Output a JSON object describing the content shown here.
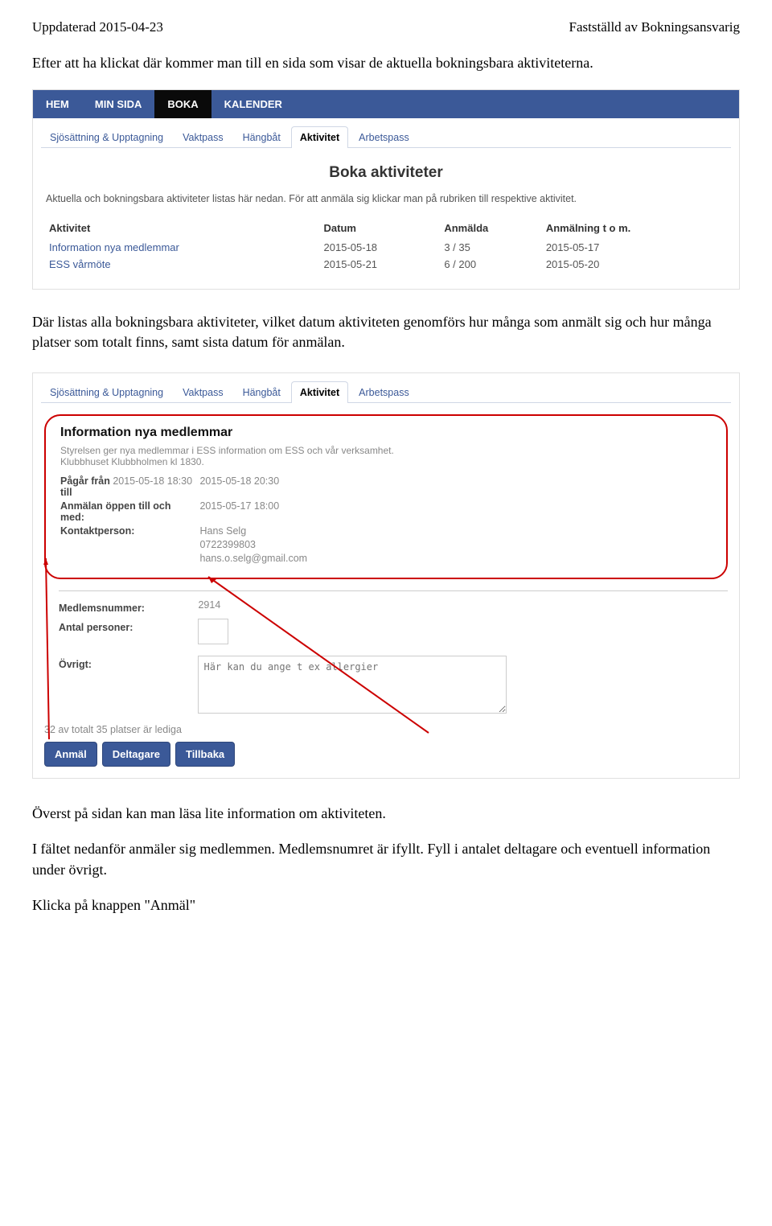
{
  "doc": {
    "updated": "Uppdaterad 2015-04-23",
    "right_header": "Fastställd av Bokningsansvarig",
    "intro": "Efter att ha klickat där kommer man till en sida som visar de aktuella bokningsbara aktiviteterna."
  },
  "nav": {
    "items": [
      "HEM",
      "MIN SIDA",
      "BOKA",
      "KALENDER"
    ],
    "active_index": 2
  },
  "subtabs": {
    "items": [
      "Sjösättning & Upptagning",
      "Vaktpass",
      "Hängbåt",
      "Aktivitet",
      "Arbetspass"
    ],
    "active_index": 3
  },
  "panel1": {
    "title": "Boka aktiviteter",
    "desc": "Aktuella och bokningsbara aktiviteter listas här nedan. För att anmäla sig klickar man på rubriken till respektive aktivitet.",
    "headers": {
      "col0": "Aktivitet",
      "col1": "Datum",
      "col2": "Anmälda",
      "col3": "Anmälning t o m."
    },
    "rows": [
      {
        "name": "Information nya medlemmar",
        "date": "2015-05-18",
        "signed": "3 / 35",
        "deadline": "2015-05-17"
      },
      {
        "name": "ESS vårmöte",
        "date": "2015-05-21",
        "signed": "6 / 200",
        "deadline": "2015-05-20"
      }
    ]
  },
  "mid_text": "Där listas alla bokningsbara aktiviteter, vilket datum aktiviteten genomförs hur många som anmält sig och hur många platser som totalt finns, samt sista datum för anmälan.",
  "panel2": {
    "title": "Information nya medlemmar",
    "desc_line1": "Styrelsen ger nya medlemmar i ESS information om ESS och vår verksamhet.",
    "desc_line2": "Klubbhuset Klubbholmen kl 1830.",
    "from_label": "Pågår från",
    "from_value": "2015-05-18 18:30",
    "to_label": "till",
    "to_value": "2015-05-18 20:30",
    "open_label": "Anmälan öppen till och med:",
    "open_value": "2015-05-17 18:00",
    "contact_label": "Kontaktperson:",
    "contact_name": "Hans Selg",
    "contact_phone": "0722399803",
    "contact_email": "hans.o.selg@gmail.com",
    "member_label": "Medlemsnummer:",
    "member_value": "2914",
    "persons_label": "Antal personer:",
    "other_label": "Övrigt:",
    "other_placeholder": "Här kan du ange t ex allergier",
    "seats_text": "32 av totalt 35 platser är lediga",
    "btn_apply": "Anmäl",
    "btn_participants": "Deltagare",
    "btn_back": "Tillbaka"
  },
  "bottom": {
    "line1": "Överst på sidan kan man läsa lite information om aktiviteten.",
    "line2": "I fältet nedanför anmäler sig medlemmen. Medlemsnumret är ifyllt. Fyll i antalet deltagare och eventuell information under övrigt.",
    "line3": "Klicka på knappen \"Anmäl\""
  }
}
